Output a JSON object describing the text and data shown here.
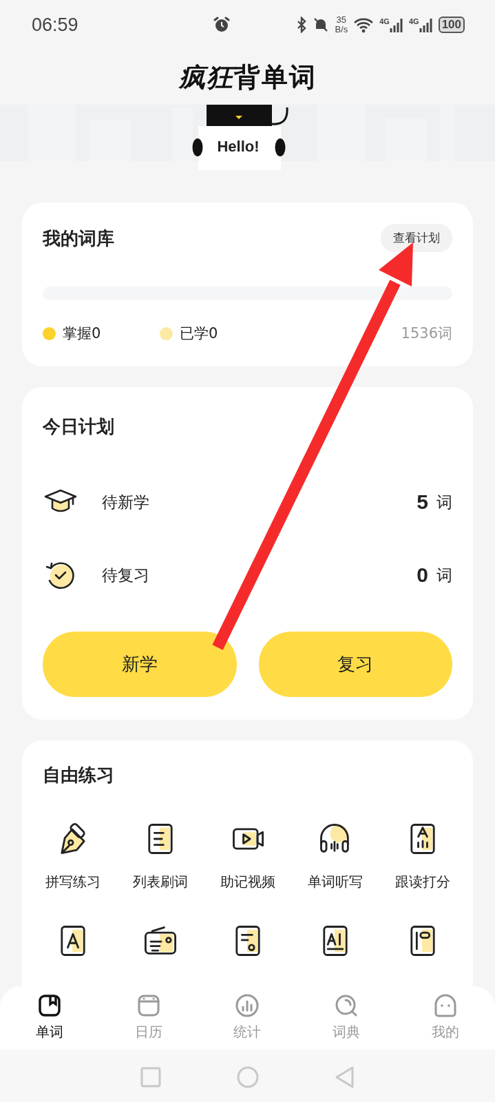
{
  "status_bar": {
    "time": "06:59",
    "speed_value": "35",
    "speed_unit": "B/s",
    "networks": [
      "4G",
      "4G"
    ],
    "battery": "100"
  },
  "header": {
    "logo_accent": "疯狂",
    "logo_text": "背单词",
    "mascot_sign": "Hello!"
  },
  "library": {
    "title": "我的词库",
    "plan_button": "查看计划",
    "progress": {
      "level": 0
    },
    "legend": [
      {
        "label": "掌握0",
        "color": "#fdd22a"
      },
      {
        "label": "已学0",
        "color": "#fde9a3"
      }
    ],
    "total": "1536词"
  },
  "today": {
    "title": "今日计划",
    "rows": [
      {
        "kind": "new",
        "label": "待新学",
        "count": "5",
        "unit": "词"
      },
      {
        "kind": "review",
        "label": "待复习",
        "count": "0",
        "unit": "词"
      }
    ],
    "buttons": [
      "新学",
      "复习"
    ]
  },
  "practice": {
    "title": "自由练习",
    "items": [
      {
        "kind": "pen",
        "label": "拼写练习"
      },
      {
        "kind": "list",
        "label": "列表刷词"
      },
      {
        "kind": "video",
        "label": "助记视频"
      },
      {
        "kind": "headphones",
        "label": "单词听写"
      },
      {
        "kind": "read",
        "label": "跟读打分"
      },
      {
        "kind": "letter"
      },
      {
        "kind": "radio"
      },
      {
        "kind": "card"
      },
      {
        "kind": "ai"
      },
      {
        "kind": "notebook"
      }
    ]
  },
  "tabs": [
    {
      "kind": "book",
      "label": "单词",
      "selected": true
    },
    {
      "kind": "calendar",
      "label": "日历",
      "selected": false
    },
    {
      "kind": "chart",
      "label": "统计",
      "selected": false
    },
    {
      "kind": "search",
      "label": "词典",
      "selected": false
    },
    {
      "kind": "ghost",
      "label": "我的",
      "selected": false
    }
  ]
}
